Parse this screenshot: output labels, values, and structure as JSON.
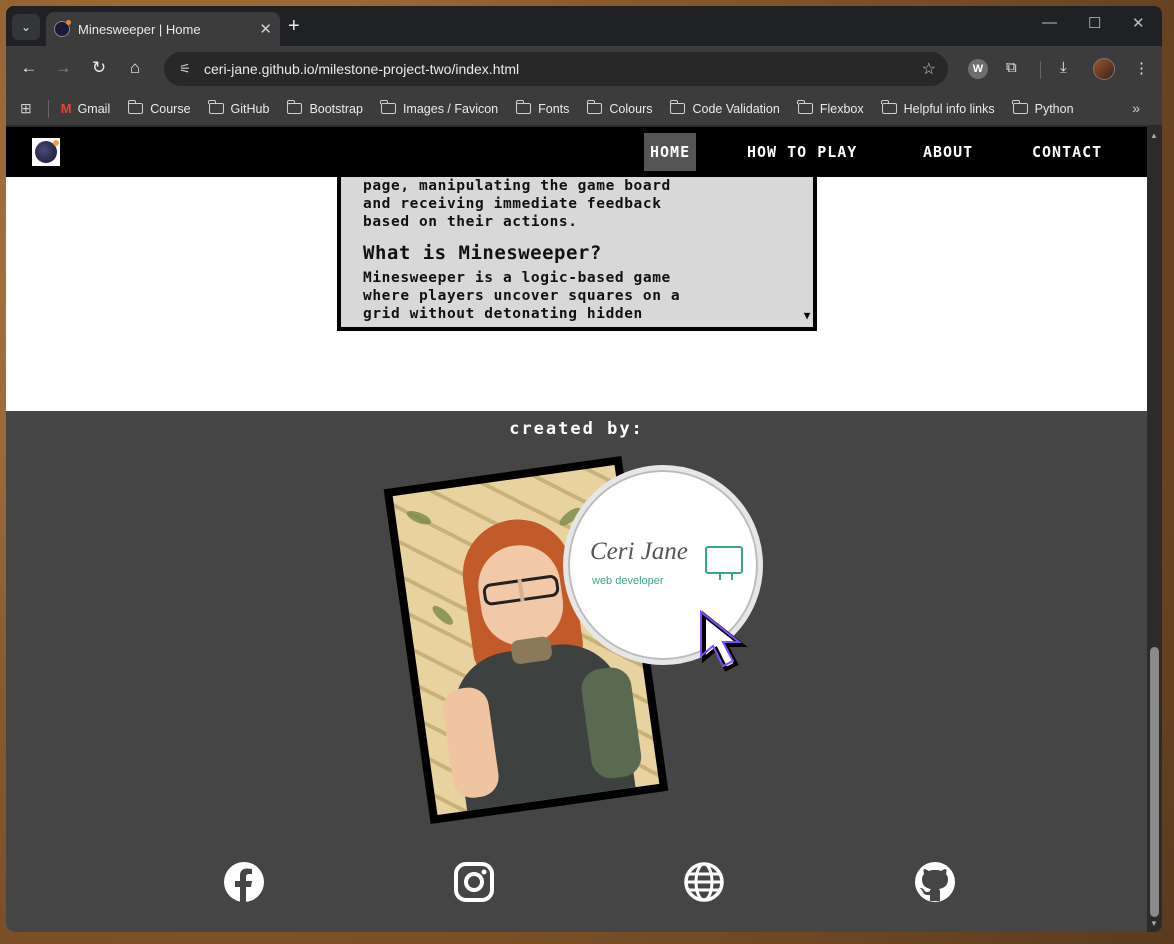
{
  "browser": {
    "tab_title": "Minesweeper | Home",
    "tab_close": "✕",
    "new_tab": "+",
    "url": "ceri-jane.github.io/milestone-project-two/index.html",
    "bookmarks": [
      "Gmail",
      "Course",
      "GitHub",
      "Bootstrap",
      "Images / Favicon",
      "Fonts",
      "Colours",
      "Code Validation",
      "Flexbox",
      "Helpful info links",
      "Python"
    ],
    "bookmark_more": "»",
    "icons": {
      "tab_list": "chevron-down-icon",
      "back": "back-arrow-icon",
      "forward": "forward-arrow-icon",
      "reload": "reload-icon",
      "home": "home-icon",
      "site_info": "tune-icon",
      "bookmark_star": "star-icon",
      "extensions": "puzzle-icon",
      "downloads": "download-icon",
      "menu": "kebab-menu-icon"
    }
  },
  "site": {
    "nav": {
      "home": "HOME",
      "how_to_play": "HOW TO PLAY",
      "about": "ABOUT",
      "contact": "CONTACT"
    },
    "intro": {
      "paragraph_tail_1": "page, manipulating the game board",
      "paragraph_tail_2": "and receiving immediate feedback",
      "paragraph_tail_3": "based on their actions.",
      "heading": "What is Minesweeper?",
      "paragraph_1": "Minesweeper is a logic-based game",
      "paragraph_2": "where players uncover squares on a",
      "paragraph_3": "grid without detonating hidden"
    },
    "footer": {
      "created_by": "created by:",
      "logo_name": "Ceri Jane",
      "logo_subtitle": "web developer",
      "social_icons": [
        "facebook-icon",
        "instagram-icon",
        "globe-icon",
        "github-icon"
      ]
    }
  },
  "colors": {
    "nav_bg": "#000000",
    "nav_active": "#555555",
    "footer_bg": "#454545",
    "textbox_bg": "#d8d8d8",
    "logo_accent": "#3ba58a"
  }
}
